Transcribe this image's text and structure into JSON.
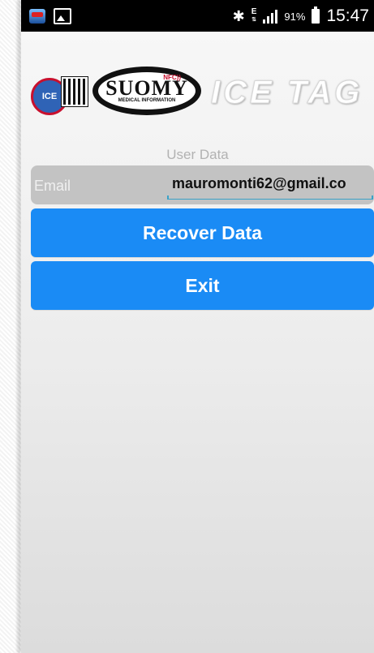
{
  "status_bar": {
    "network": "E",
    "battery_percent": "91%",
    "time": "15:47"
  },
  "logo": {
    "ice_badge": "ICE",
    "nfc": "NFC))",
    "brand": "SUOMY",
    "brand_sub": "MEDICAL INFORMATION",
    "product": "ICE TAG"
  },
  "form": {
    "section_label": "User Data",
    "email_label": "Email",
    "email_value": "mauromonti62@gmail.co"
  },
  "buttons": {
    "recover_label": "Recover Data",
    "exit_label": "Exit"
  }
}
